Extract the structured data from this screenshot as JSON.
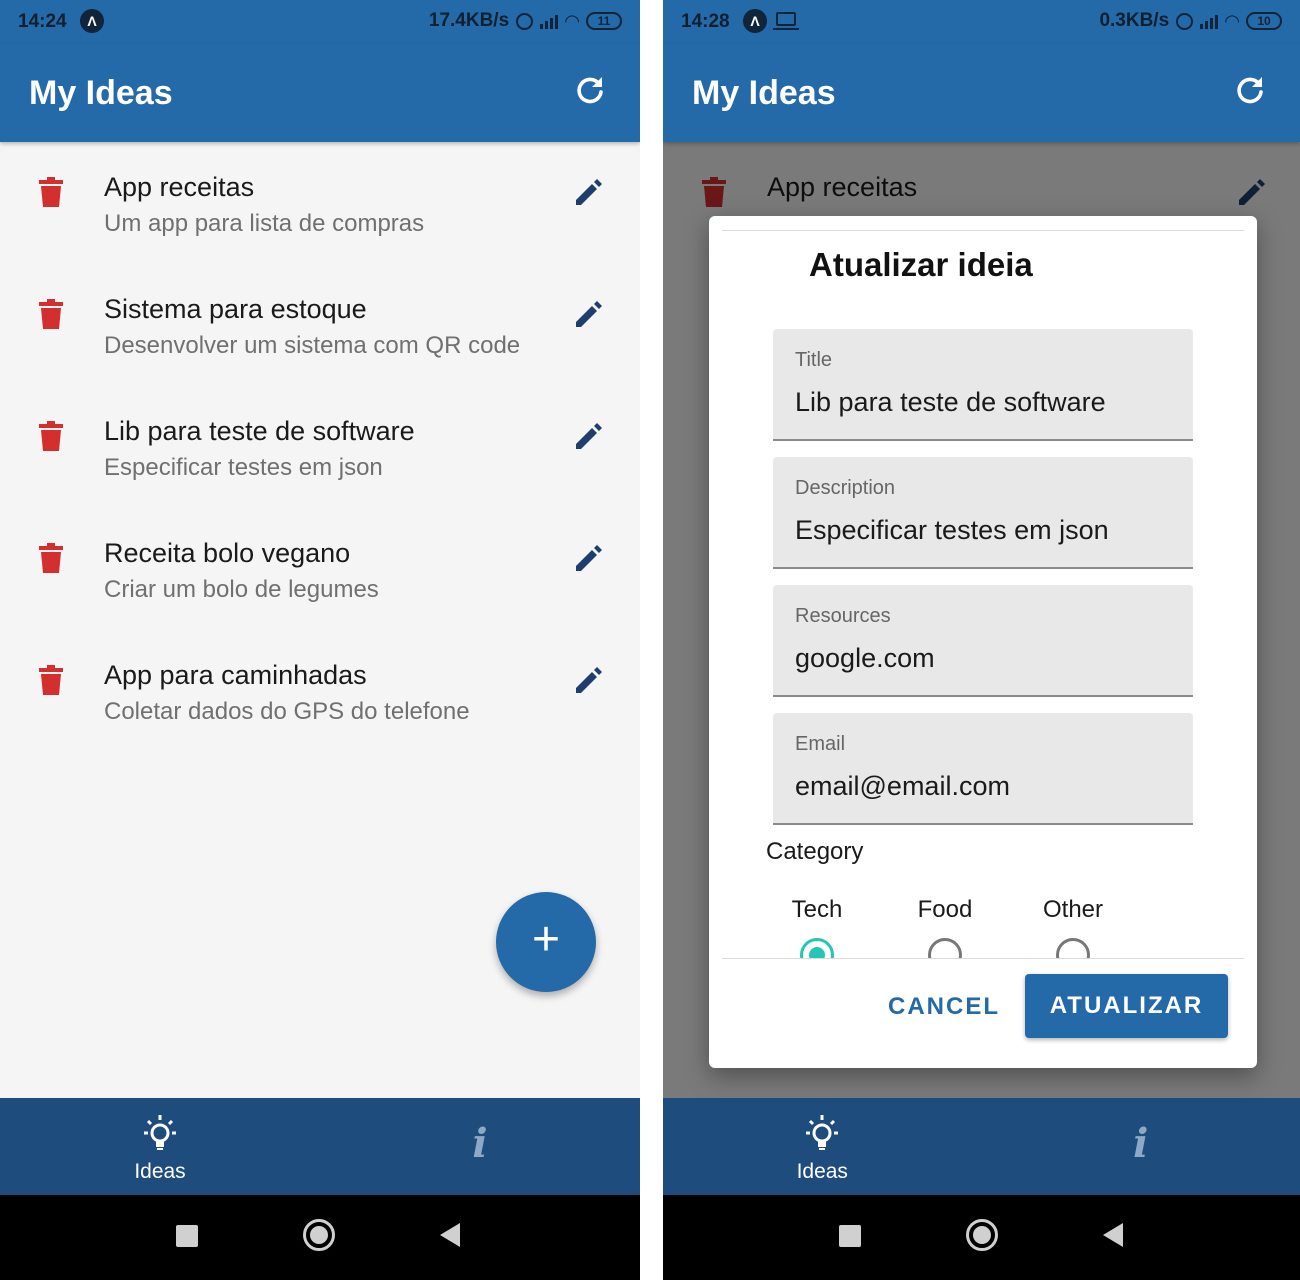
{
  "colors": {
    "primary": "#2469a8",
    "bottom_nav": "#1e4d7d",
    "trash": "#d32f2f",
    "pencil": "#1e3f6e",
    "radio_selected": "#26c6b4"
  },
  "left": {
    "status": {
      "time": "14:24",
      "badge": "Λ",
      "net_speed": "17.4KB/s",
      "battery": "11"
    },
    "appbar": {
      "title": "My Ideas",
      "refresh_icon": "refresh-icon"
    },
    "ideas": [
      {
        "title": "App receitas",
        "description": "Um app para lista de compras"
      },
      {
        "title": "Sistema para estoque",
        "description": "Desenvolver um sistema com QR code"
      },
      {
        "title": "Lib para teste de software",
        "description": "Especificar testes em json"
      },
      {
        "title": "Receita bolo vegano",
        "description": "Criar um bolo de legumes"
      },
      {
        "title": "App para caminhadas",
        "description": "Coletar dados do GPS do telefone"
      }
    ],
    "fab": {
      "label": "+"
    },
    "bottom_nav": {
      "ideas_label": "Ideas",
      "info_label": "i"
    }
  },
  "right": {
    "status": {
      "time": "14:28",
      "badge": "Λ",
      "net_speed": "0.3KB/s",
      "battery": "10"
    },
    "appbar": {
      "title": "My Ideas"
    },
    "background_first_title": "App receitas",
    "dialog": {
      "title": "Atualizar ideia",
      "fields": [
        {
          "label": "Title",
          "value": "Lib para teste de software"
        },
        {
          "label": "Description",
          "value": "Especificar testes em json"
        },
        {
          "label": "Resources",
          "value": "google.com"
        },
        {
          "label": "Email",
          "value": "email@email.com"
        }
      ],
      "category_label": "Category",
      "category_options": [
        "Tech",
        "Food",
        "Other"
      ],
      "category_selected": "Tech",
      "cancel_label": "CANCEL",
      "submit_label": "ATUALIZAR"
    },
    "bottom_nav": {
      "ideas_label": "Ideas",
      "info_label": "i"
    }
  }
}
